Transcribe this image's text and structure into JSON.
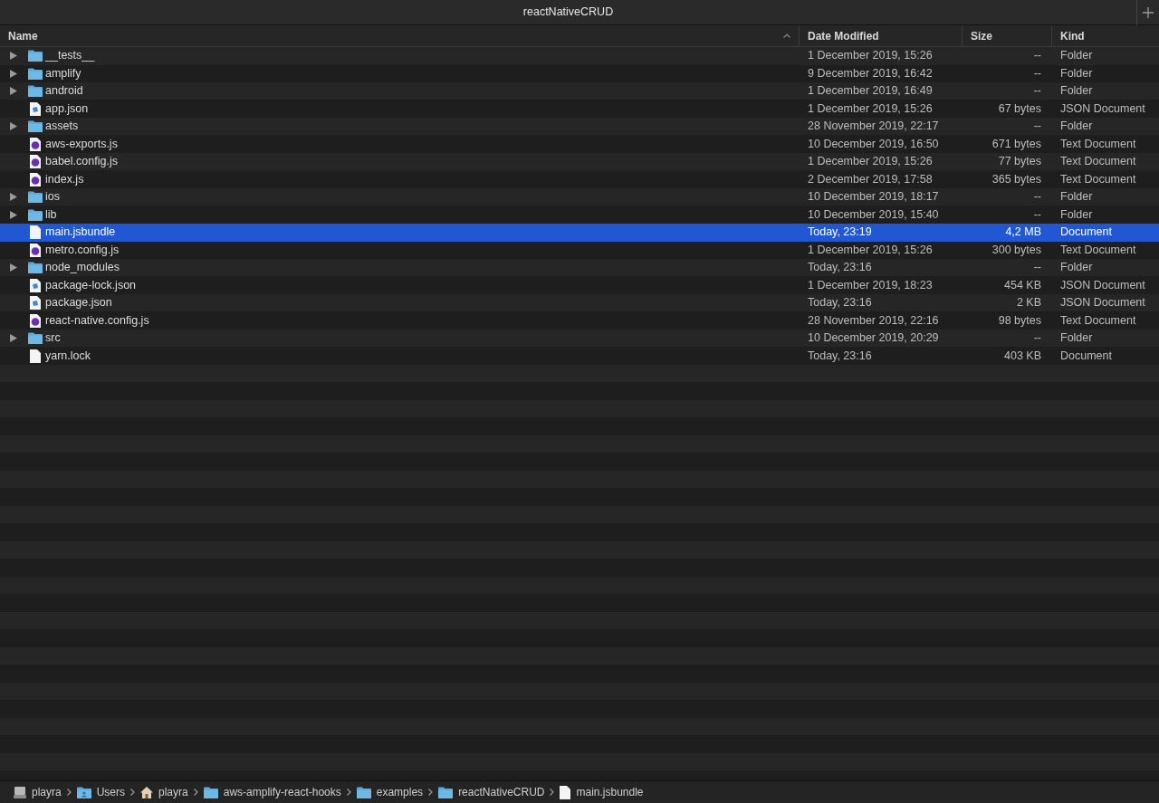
{
  "window": {
    "title": "reactNativeCRUD"
  },
  "columns": [
    {
      "label": "Name",
      "sorted": true
    },
    {
      "label": "Date Modified",
      "sorted": false
    },
    {
      "label": "Size",
      "sorted": false
    },
    {
      "label": "Kind",
      "sorted": false
    }
  ],
  "files": [
    {
      "name": "__tests__",
      "kind": "folder",
      "date": "1 December 2019, 15:26",
      "size": "--",
      "file_kind": "Folder",
      "selected": false
    },
    {
      "name": "amplify",
      "kind": "folder",
      "date": "9 December 2019, 16:42",
      "size": "--",
      "file_kind": "Folder",
      "selected": false
    },
    {
      "name": "android",
      "kind": "folder",
      "date": "1 December 2019, 16:49",
      "size": "--",
      "file_kind": "Folder",
      "selected": false
    },
    {
      "name": "app.json",
      "kind": "json",
      "date": "1 December 2019, 15:26",
      "size": "67 bytes",
      "file_kind": "JSON Document",
      "selected": false
    },
    {
      "name": "assets",
      "kind": "folder",
      "date": "28 November 2019, 22:17",
      "size": "--",
      "file_kind": "Folder",
      "selected": false
    },
    {
      "name": "aws-exports.js",
      "kind": "js",
      "date": "10 December 2019, 16:50",
      "size": "671 bytes",
      "file_kind": "Text Document",
      "selected": false
    },
    {
      "name": "babel.config.js",
      "kind": "js",
      "date": "1 December 2019, 15:26",
      "size": "77 bytes",
      "file_kind": "Text Document",
      "selected": false
    },
    {
      "name": "index.js",
      "kind": "js",
      "date": "2 December 2019, 17:58",
      "size": "365 bytes",
      "file_kind": "Text Document",
      "selected": false
    },
    {
      "name": "ios",
      "kind": "folder",
      "date": "10 December 2019, 18:17",
      "size": "--",
      "file_kind": "Folder",
      "selected": false
    },
    {
      "name": "lib",
      "kind": "folder",
      "date": "10 December 2019, 15:40",
      "size": "--",
      "file_kind": "Folder",
      "selected": false
    },
    {
      "name": "main.jsbundle",
      "kind": "doc",
      "date": "Today, 23:19",
      "size": "4,2 MB",
      "file_kind": "Document",
      "selected": true
    },
    {
      "name": "metro.config.js",
      "kind": "js",
      "date": "1 December 2019, 15:26",
      "size": "300 bytes",
      "file_kind": "Text Document",
      "selected": false
    },
    {
      "name": "node_modules",
      "kind": "folder",
      "date": "Today, 23:16",
      "size": "--",
      "file_kind": "Folder",
      "selected": false
    },
    {
      "name": "package-lock.json",
      "kind": "json",
      "date": "1 December 2019, 18:23",
      "size": "454 KB",
      "file_kind": "JSON Document",
      "selected": false
    },
    {
      "name": "package.json",
      "kind": "json",
      "date": "Today, 23:16",
      "size": "2 KB",
      "file_kind": "JSON Document",
      "selected": false
    },
    {
      "name": "react-native.config.js",
      "kind": "js",
      "date": "28 November 2019, 22:16",
      "size": "98 bytes",
      "file_kind": "Text Document",
      "selected": false
    },
    {
      "name": "src",
      "kind": "folder",
      "date": "10 December 2019, 20:29",
      "size": "--",
      "file_kind": "Folder",
      "selected": false
    },
    {
      "name": "yarn.lock",
      "kind": "doc",
      "date": "Today, 23:16",
      "size": "403 KB",
      "file_kind": "Document",
      "selected": false
    }
  ],
  "path_bar": [
    {
      "label": "playra",
      "kind": "disk"
    },
    {
      "label": "Users",
      "kind": "users"
    },
    {
      "label": "playra",
      "kind": "home"
    },
    {
      "label": "aws-amplify-react-hooks",
      "kind": "folder"
    },
    {
      "label": "examples",
      "kind": "folder"
    },
    {
      "label": "reactNativeCRUD",
      "kind": "folder"
    },
    {
      "label": "main.jsbundle",
      "kind": "doc"
    }
  ]
}
